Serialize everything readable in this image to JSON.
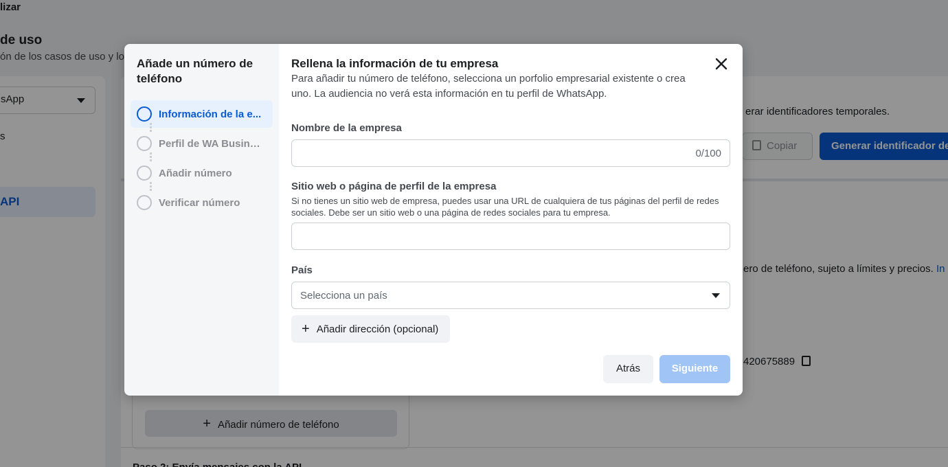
{
  "background": {
    "top_text": "lizar",
    "section_title": "de uso",
    "section_subtitle": "ón de los casos de uso y lo",
    "sidebar_select_value": "sApp",
    "sidebar_item": "s",
    "sidebar_api": "API",
    "token_text": "erar identificadores temporales.",
    "copy_label": "Copiar",
    "generate_label": "Generar identificador de",
    "phone_text": "ero de teléfono, sujeto a límites y precios.",
    "phone_link": "In",
    "phone_number": "420675889",
    "add_phone_label": "Añadir número de teléfono",
    "step2_title": "Paso 2: Envía mensajes con la API"
  },
  "dialog": {
    "sidebar_title": "Añade un número de teléfono",
    "steps": [
      {
        "label": "Información de la e...",
        "active": true
      },
      {
        "label": "Perfil de WA Business",
        "active": false
      },
      {
        "label": "Añadir número",
        "active": false
      },
      {
        "label": "Verificar número",
        "active": false
      }
    ],
    "title": "Rellena la información de tu empresa",
    "description": "Para añadir tu número de teléfono, selecciona un porfolio empresarial existente o crea uno. La audiencia no verá esta información en tu perfil de WhatsApp.",
    "business_name": {
      "label": "Nombre de la empresa",
      "value": "",
      "counter": "0/100"
    },
    "website": {
      "label": "Sitio web o página de perfil de la empresa",
      "help": "Si no tienes un sitio web de empresa, puedes usar una URL de cualquiera de tus páginas del perfil de redes sociales. Debe ser un sitio web o una página de redes sociales para tu empresa.",
      "value": ""
    },
    "country": {
      "label": "País",
      "placeholder": "Selecciona un país"
    },
    "add_address_label": "Añadir dirección (opcional)",
    "back_label": "Atrás",
    "next_label": "Siguiente"
  },
  "colors": {
    "accent": "#0a5bd3",
    "accent_disabled": "#a0c4f5",
    "overlay": "rgba(0,0,0,0.42)"
  },
  "icons": {
    "close": "close-icon",
    "caret": "caret-down-icon",
    "plus": "plus-icon",
    "copy": "copy-icon"
  }
}
